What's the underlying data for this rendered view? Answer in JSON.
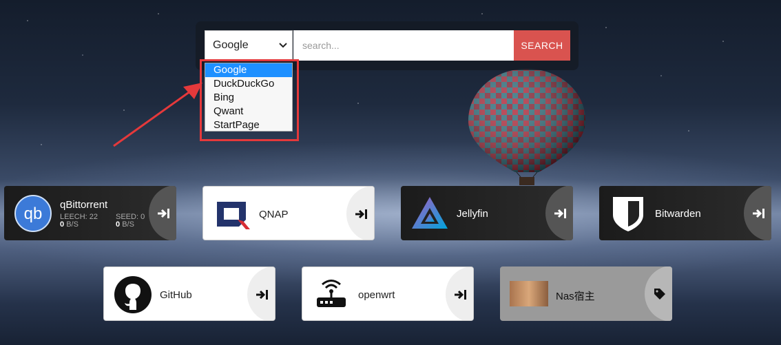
{
  "search": {
    "engine_selected": "Google",
    "engines": [
      "Google",
      "DuckDuckGo",
      "Bing",
      "Qwant",
      "StartPage"
    ],
    "placeholder": "search...",
    "button_label": "SEARCH"
  },
  "tiles_row1": [
    {
      "name": "qBittorrent",
      "icon": "qbittorrent-icon",
      "theme": "dark",
      "leech_label": "LEECH: 22",
      "seed_label": "SEED: 0",
      "leech_rate_value": "0",
      "seed_rate_value": "0",
      "rate_unit": "B/S"
    },
    {
      "name": "QNAP",
      "icon": "qnap-icon",
      "theme": "light"
    },
    {
      "name": "Jellyfin",
      "icon": "jellyfin-icon",
      "theme": "dark"
    },
    {
      "name": "Bitwarden",
      "icon": "bitwarden-icon",
      "theme": "dark"
    }
  ],
  "tiles_row2": [
    {
      "name": "GitHub",
      "icon": "github-icon",
      "theme": "light"
    },
    {
      "name": "openwrt",
      "icon": "router-icon",
      "theme": "light"
    },
    {
      "name": "Nas宿主",
      "icon": "thumbnail-image",
      "theme": "gray"
    }
  ],
  "colors": {
    "search_button": "#d9534f",
    "annotation": "#e5393b",
    "selected_option": "#1e90ff"
  }
}
